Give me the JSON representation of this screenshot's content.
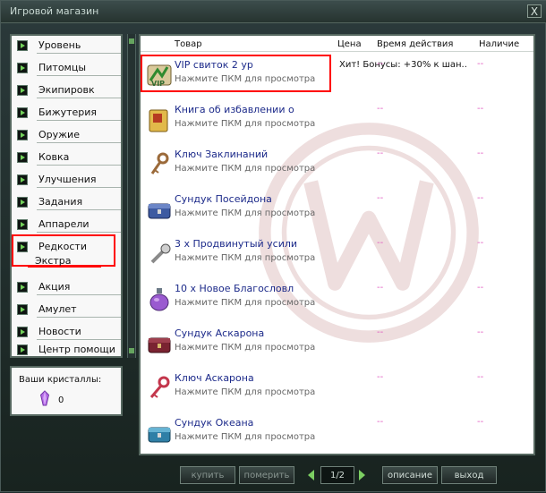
{
  "window": {
    "title": "Игровой магазин",
    "close_glyph": "X"
  },
  "categories": [
    {
      "label": "Уровень"
    },
    {
      "label": "Питомцы"
    },
    {
      "label": "Экипировк"
    },
    {
      "label": "Бижутерия"
    },
    {
      "label": "Оружие"
    },
    {
      "label": "Ковка"
    },
    {
      "label": "Улучшения"
    },
    {
      "label": "Задания"
    },
    {
      "label": "Аппарели"
    },
    {
      "label": "Редкости",
      "active": true
    },
    {
      "label": "Акция"
    },
    {
      "label": "Амулет"
    },
    {
      "label": "Новости"
    },
    {
      "label": "Центр помощи"
    }
  ],
  "active_subcategory": "Экстра",
  "crystals": {
    "label": "Ваши кристаллы:",
    "count": "0"
  },
  "table": {
    "headers": {
      "item": "Товар",
      "price": "Цена",
      "duration": "Время действия",
      "stock": "Наличие"
    },
    "rows": [
      {
        "name": "VIP свиток 2 ур",
        "hint": "Нажмите ПКМ для просмотра",
        "price": "Хит! Бонусы: +30% к шан..",
        "duration": "--",
        "stock": "--",
        "icon": "vip-scroll-icon"
      },
      {
        "name": "Книга об избавлении о",
        "hint": "Нажмите ПКМ для просмотра",
        "price": "",
        "duration": "--",
        "stock": "--",
        "icon": "book-icon"
      },
      {
        "name": "Ключ Заклинаний",
        "hint": "Нажмите ПКМ для просмотра",
        "price": "",
        "duration": "--",
        "stock": "--",
        "icon": "key-icon"
      },
      {
        "name": "Сундук Посейдона",
        "hint": "Нажмите ПКМ для просмотра",
        "price": "",
        "duration": "--",
        "stock": "--",
        "icon": "chest-icon"
      },
      {
        "name": "3 x Продвинутый усили",
        "hint": "Нажмите ПКМ для просмотра",
        "price": "",
        "duration": "--",
        "stock": "--",
        "icon": "amplifier-icon"
      },
      {
        "name": "10 x Новое Благословл",
        "hint": "Нажмите ПКМ для просмотра",
        "price": "",
        "duration": "--",
        "stock": "--",
        "icon": "potion-icon"
      },
      {
        "name": "Сундук Аскарона",
        "hint": "Нажмите ПКМ для просмотра",
        "price": "",
        "duration": "--",
        "stock": "--",
        "icon": "chest-icon"
      },
      {
        "name": "Ключ Аскарона",
        "hint": "Нажмите ПКМ для просмотра",
        "price": "",
        "duration": "--",
        "stock": "--",
        "icon": "key-icon"
      },
      {
        "name": "Сундук Океана",
        "hint": "Нажмите ПКМ для просмотра",
        "price": "",
        "duration": "--",
        "stock": "--",
        "icon": "chest-icon"
      }
    ]
  },
  "buttons": {
    "buy": "купить",
    "try_on": "померить",
    "description": "описание",
    "exit": "выход"
  },
  "pagination": {
    "label": "1/2"
  }
}
